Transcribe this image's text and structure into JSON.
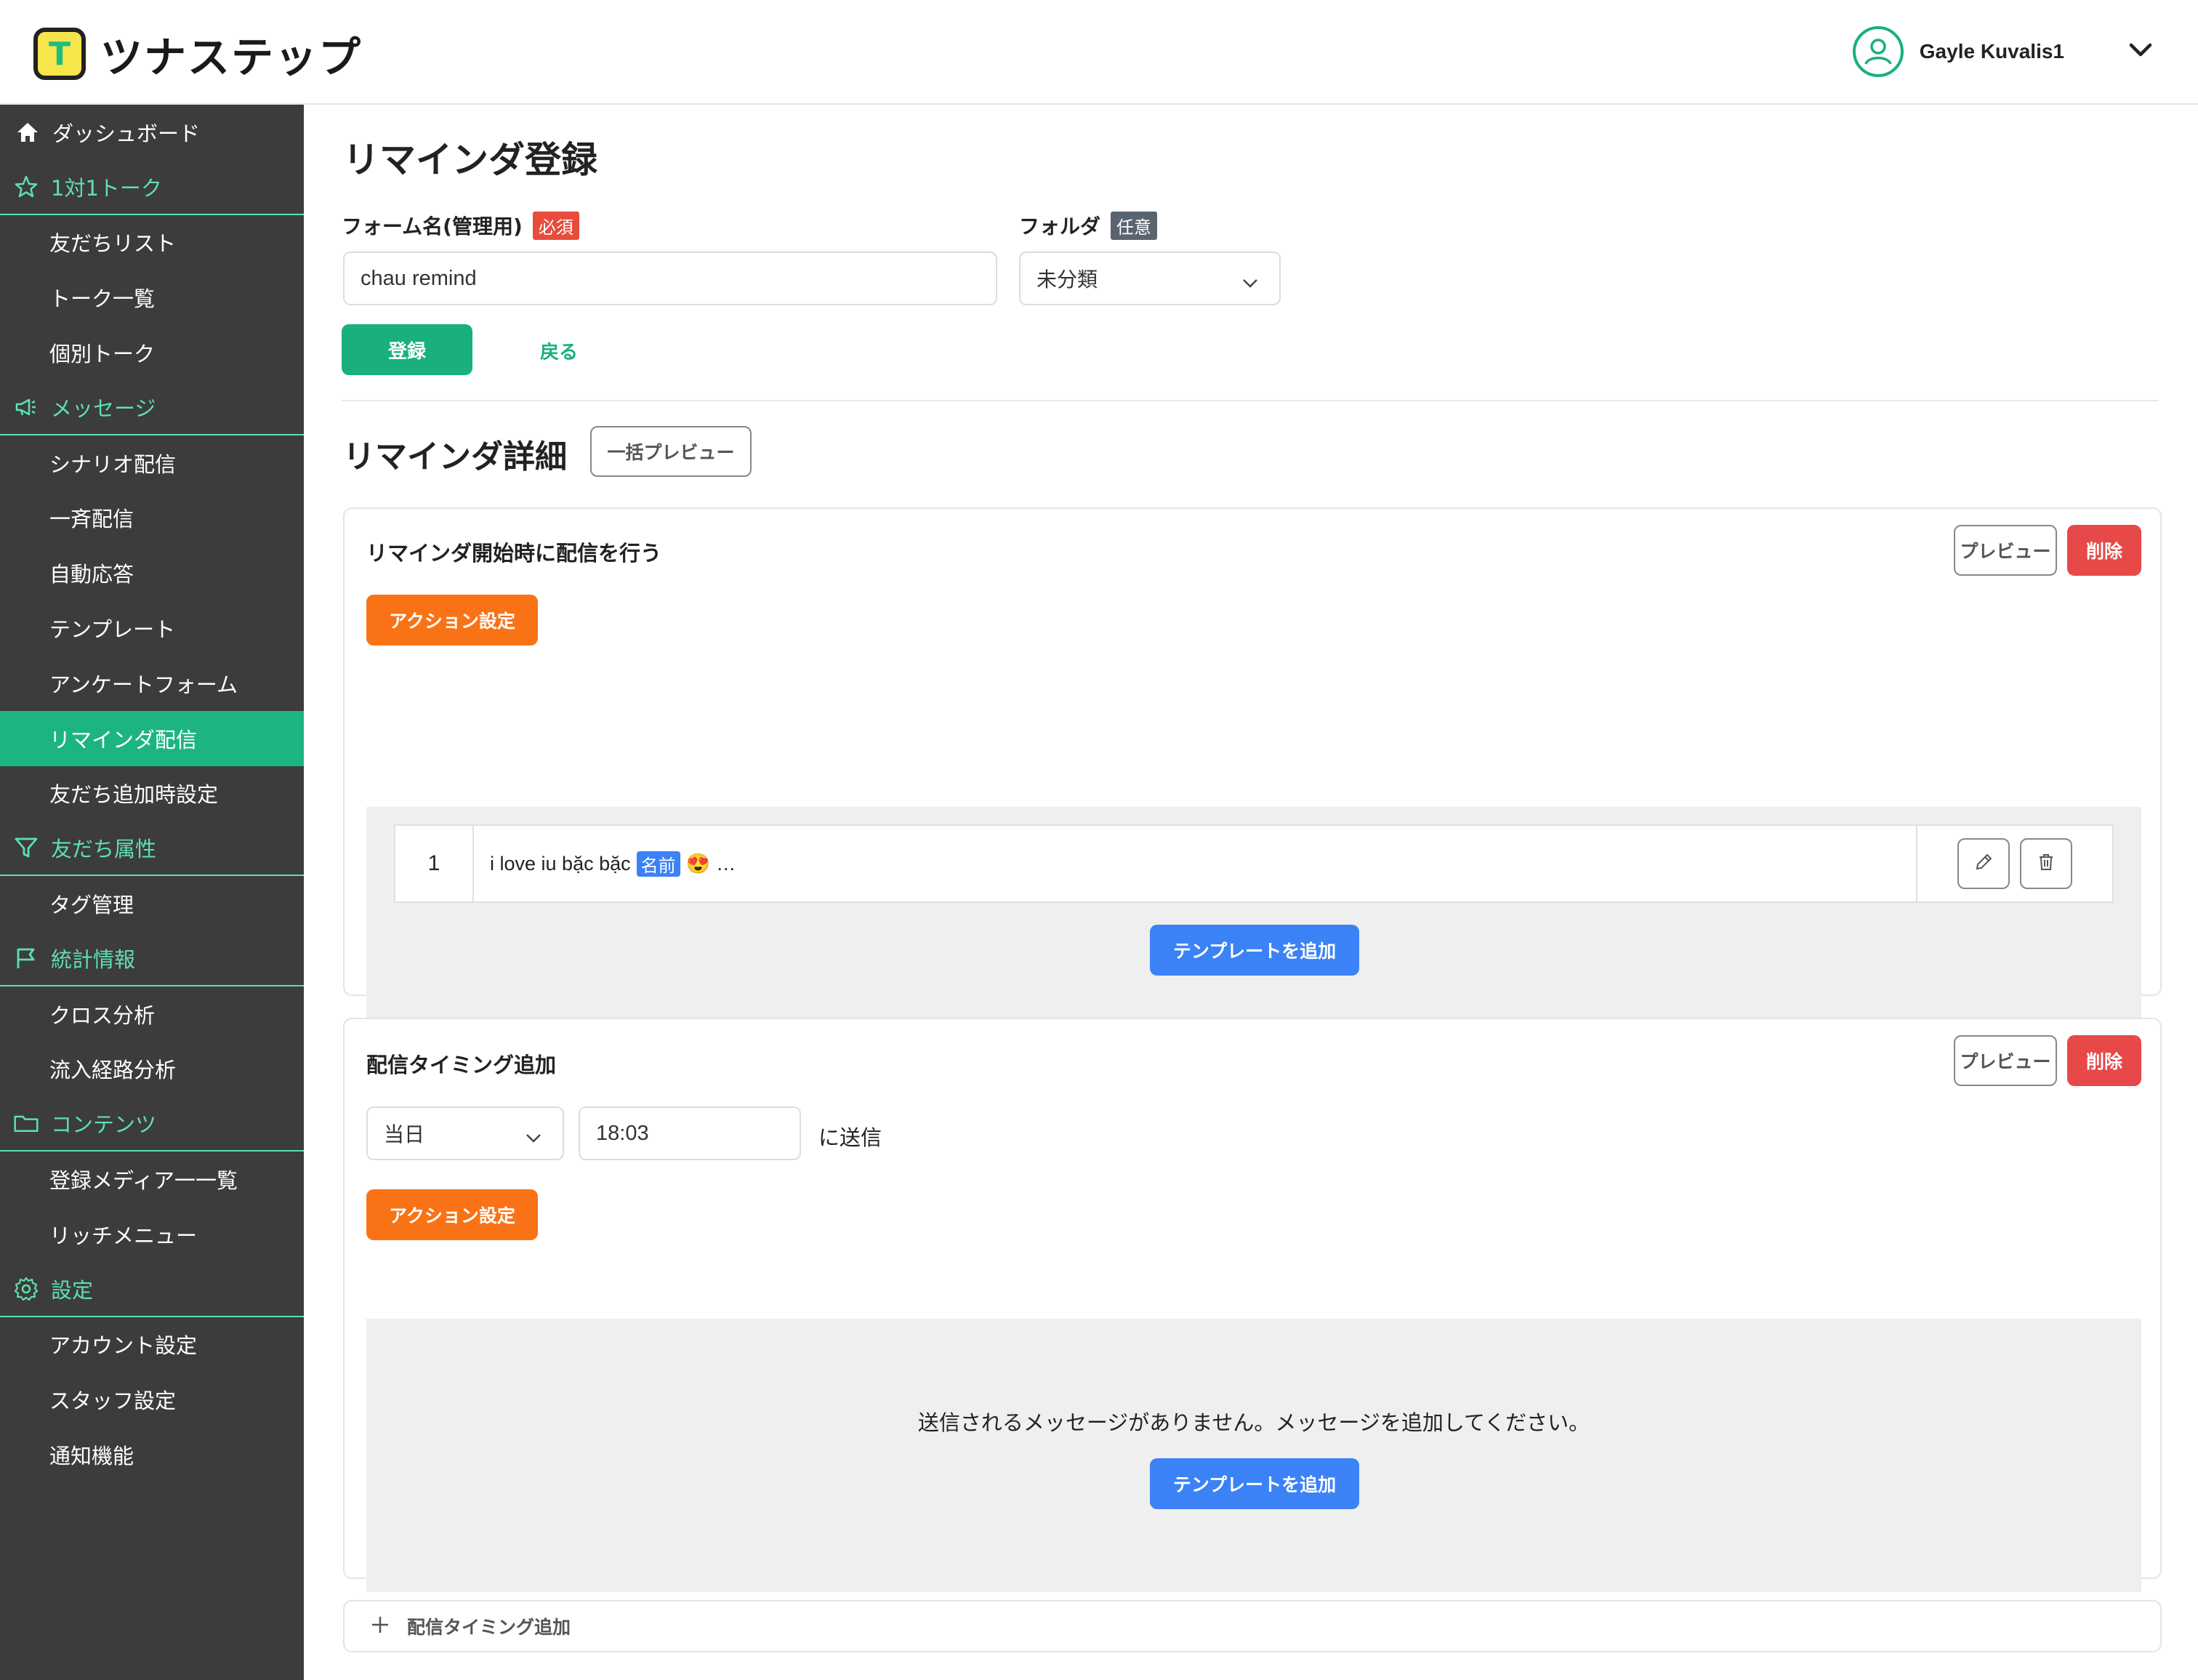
{
  "header": {
    "logo_letter": "T",
    "logo_text": "ツナステップ",
    "user_name": "Gayle Kuvalis1"
  },
  "sidebar": {
    "items": [
      {
        "label": "ダッシュボード",
        "type": "top",
        "icon": "home-icon"
      },
      {
        "label": "1対1トーク",
        "type": "section",
        "icon": "star-icon"
      },
      {
        "label": "友だちリスト",
        "type": "item"
      },
      {
        "label": "トーク一覧",
        "type": "item"
      },
      {
        "label": "個別トーク",
        "type": "item"
      },
      {
        "label": "メッセージ",
        "type": "section",
        "icon": "megaphone-icon"
      },
      {
        "label": "シナリオ配信",
        "type": "item"
      },
      {
        "label": "一斉配信",
        "type": "item"
      },
      {
        "label": "自動応答",
        "type": "item"
      },
      {
        "label": "テンプレート",
        "type": "item"
      },
      {
        "label": "アンケートフォーム",
        "type": "item"
      },
      {
        "label": "リマインダ配信",
        "type": "item",
        "active": true
      },
      {
        "label": "友だち追加時設定",
        "type": "item"
      },
      {
        "label": "友だち属性",
        "type": "section",
        "icon": "filter-icon"
      },
      {
        "label": "タグ管理",
        "type": "item"
      },
      {
        "label": "統計情報",
        "type": "section",
        "icon": "flag-icon"
      },
      {
        "label": "クロス分析",
        "type": "item"
      },
      {
        "label": "流入経路分析",
        "type": "item"
      },
      {
        "label": "コンテンツ",
        "type": "section",
        "icon": "folder-icon"
      },
      {
        "label": "登録メディア一一覧",
        "type": "item"
      },
      {
        "label": "リッチメニュー",
        "type": "item"
      },
      {
        "label": "設定",
        "type": "section",
        "icon": "gear-icon"
      },
      {
        "label": "アカウント設定",
        "type": "item"
      },
      {
        "label": "スタッフ設定",
        "type": "item"
      },
      {
        "label": "通知機能",
        "type": "item"
      }
    ]
  },
  "form": {
    "page_title": "リマインダ登録",
    "name_label": "フォーム名(管理用)",
    "name_badge": "必須",
    "name_value": "chau remind",
    "folder_label": "フォルダ",
    "folder_badge": "任意",
    "folder_value": "未分類",
    "submit_label": "登録",
    "back_label": "戻る"
  },
  "details": {
    "title": "リマインダ詳細",
    "bulk_preview_label": "一括プレビュー",
    "card1": {
      "title": "リマインダ開始時に配信を行う",
      "preview_label": "プレビュー",
      "delete_label": "削除",
      "action_label": "アクション設定",
      "messages": [
        {
          "num": "1",
          "text": "i love iu bặc bặc",
          "tag": "名前",
          "emoji": "😍",
          "suffix": "…"
        }
      ],
      "add_template_label": "テンプレートを追加"
    },
    "card2": {
      "title": "配信タイミング追加",
      "preview_label": "プレビュー",
      "delete_label": "削除",
      "day_value": "当日",
      "time_value": "18:03",
      "send_suffix": "に送信",
      "action_label": "アクション設定",
      "empty_text": "送信されるメッセージがありません。メッセージを追加してください。",
      "add_template_label": "テンプレートを追加"
    },
    "add_timing_label": "配信タイミング追加"
  },
  "colors": {
    "brand_green": "#19b07c",
    "sidebar_bg": "#3c3c3c",
    "section_text": "#5ee0ae",
    "danger": "#e74848",
    "action": "#f97316",
    "primary": "#3b82f6"
  }
}
